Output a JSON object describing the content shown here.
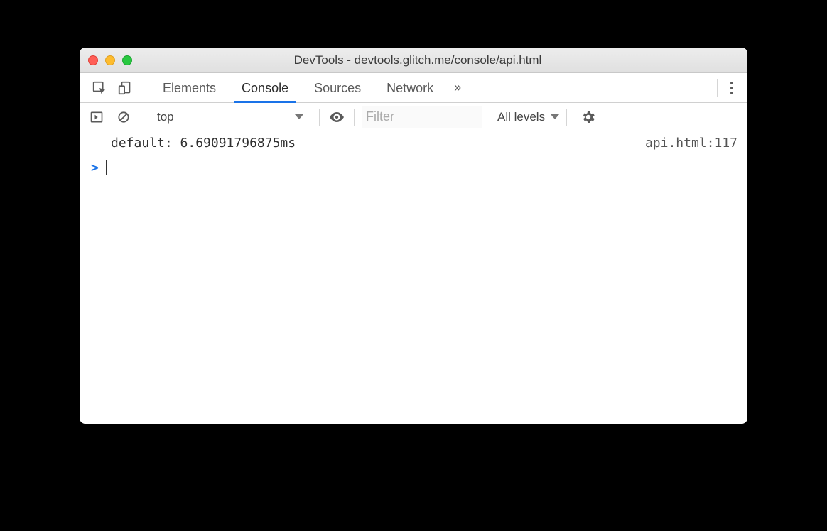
{
  "window": {
    "title": "DevTools - devtools.glitch.me/console/api.html"
  },
  "panels": {
    "tabs": [
      "Elements",
      "Console",
      "Sources",
      "Network"
    ],
    "active": "Console",
    "more_label": "»"
  },
  "console_toolbar": {
    "context": "top",
    "filter_placeholder": "Filter",
    "levels_label": "All levels"
  },
  "console": {
    "entries": [
      {
        "text": "default: 6.69091796875ms",
        "source": "api.html:117"
      }
    ],
    "prompt": ">"
  }
}
